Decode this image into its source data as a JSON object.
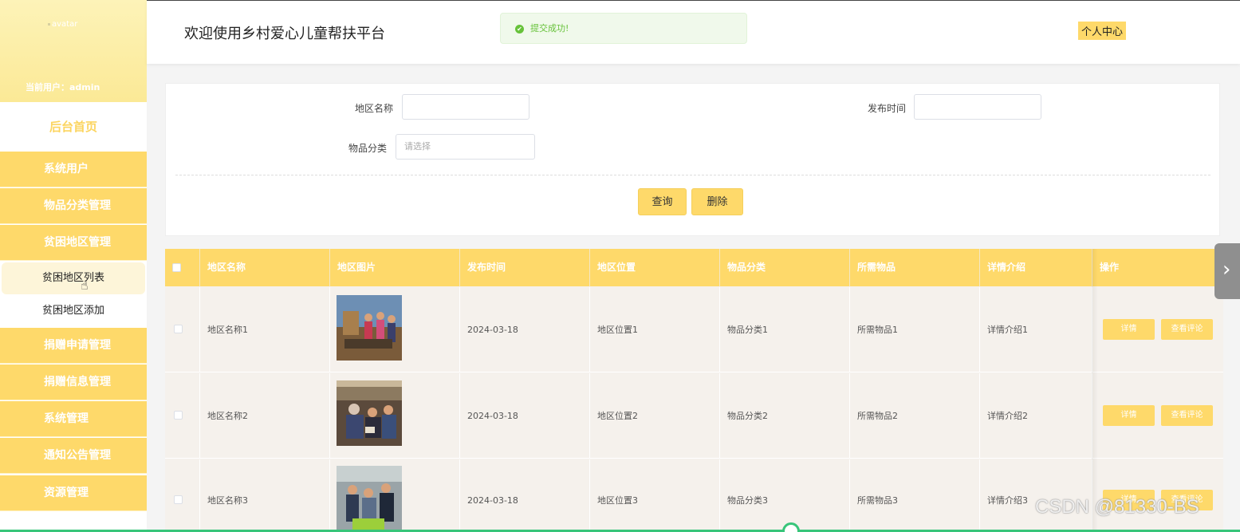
{
  "sidebar": {
    "avatar_alt": "avatar",
    "current_user_label": "当前用户：",
    "current_user": "admin",
    "home": "后台首页",
    "menu": [
      "系统用户",
      "物品分类管理",
      "贫困地区管理"
    ],
    "submenu": [
      "贫困地区列表",
      "贫困地区添加"
    ],
    "menu_bottom": [
      "捐赠申请管理",
      "捐赠信息管理",
      "系统管理",
      "通知公告管理",
      "资源管理"
    ]
  },
  "header": {
    "title": "欢迎使用乡村爱心儿童帮扶平台",
    "toast": "提交成功!",
    "profile": "个人中心"
  },
  "search": {
    "region_label": "地区名称",
    "publish_label": "发布时间",
    "category_label": "物品分类",
    "category_placeholder": "请选择",
    "query_btn": "查询",
    "delete_btn": "删除"
  },
  "table": {
    "headers": [
      "地区名称",
      "地区图片",
      "发布时间",
      "地区位置",
      "物品分类",
      "所需物品",
      "详情介绍",
      "操作"
    ],
    "rows": [
      {
        "name": "地区名称1",
        "date": "2024-03-18",
        "location": "地区位置1",
        "category": "物品分类1",
        "items": "所需物品1",
        "detail": "详情介绍1"
      },
      {
        "name": "地区名称2",
        "date": "2024-03-18",
        "location": "地区位置2",
        "category": "物品分类2",
        "items": "所需物品2",
        "detail": "详情介绍2"
      },
      {
        "name": "地区名称3",
        "date": "2024-03-18",
        "location": "地区位置3",
        "category": "物品分类3",
        "items": "所需物品3",
        "detail": "详情介绍3"
      }
    ],
    "detail_btn": "详情",
    "review_btn": "查看评论"
  },
  "watermark": "CSDN @81330-BS",
  "colors": {
    "accent": "#fed96a",
    "success": "#67c23a"
  }
}
